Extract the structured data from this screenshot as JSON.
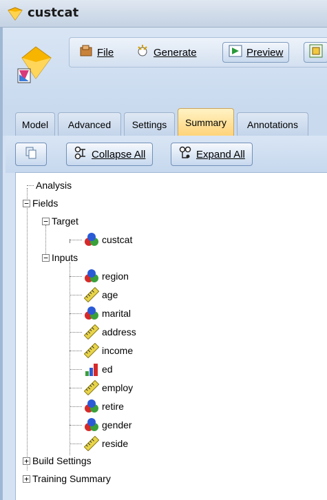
{
  "window": {
    "title": "custcat"
  },
  "toolbar": {
    "file": "File",
    "generate": "Generate",
    "preview": "Preview"
  },
  "tabs": [
    {
      "label": "Model"
    },
    {
      "label": "Advanced"
    },
    {
      "label": "Settings"
    },
    {
      "label": "Summary",
      "active": true
    },
    {
      "label": "Annotations"
    }
  ],
  "summary_toolbar": {
    "collapse": "Collapse All",
    "expand": "Expand All"
  },
  "tree": {
    "analysis": "Analysis",
    "fields": "Fields",
    "target": "Target",
    "target_field": {
      "name": "custcat",
      "type": "set-icon"
    },
    "inputs": "Inputs",
    "input_fields": [
      {
        "name": "region",
        "type": "set-icon"
      },
      {
        "name": "age",
        "type": "range-icon"
      },
      {
        "name": "marital",
        "type": "set-icon"
      },
      {
        "name": "address",
        "type": "range-icon"
      },
      {
        "name": "income",
        "type": "range-icon"
      },
      {
        "name": "ed",
        "type": "ordinal-icon"
      },
      {
        "name": "employ",
        "type": "range-icon"
      },
      {
        "name": "retire",
        "type": "set-icon"
      },
      {
        "name": "gender",
        "type": "set-icon"
      },
      {
        "name": "reside",
        "type": "range-icon"
      }
    ],
    "build_settings": "Build Settings",
    "training_summary": "Training Summary"
  },
  "colors": {
    "active_tab": "#ffd37a",
    "header": "#c9daef",
    "pane": "#d4e2f3"
  }
}
